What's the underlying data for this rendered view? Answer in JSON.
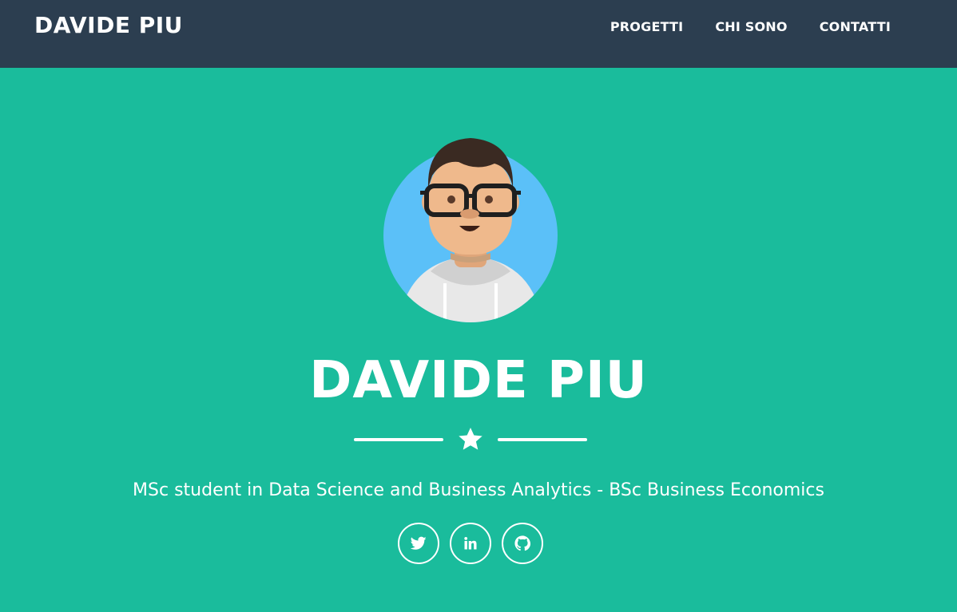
{
  "navbar": {
    "brand": "DAVIDE PIU",
    "links": [
      {
        "label": "PROGETTI"
      },
      {
        "label": "CHI SONO"
      },
      {
        "label": "CONTATTI"
      }
    ]
  },
  "hero": {
    "avatar_icon": "avatar-illustration",
    "title": "DAVIDE PIU",
    "divider_icon": "star-icon",
    "subtitle": "MSc student in Data Science and Business Analytics - BSc Business Economics"
  },
  "socials": [
    {
      "icon": "twitter-icon"
    },
    {
      "icon": "linkedin-icon"
    },
    {
      "icon": "github-icon"
    }
  ],
  "colors": {
    "navbar_bg": "#2c3e50",
    "hero_bg": "#1abc9c",
    "text": "#ffffff"
  }
}
